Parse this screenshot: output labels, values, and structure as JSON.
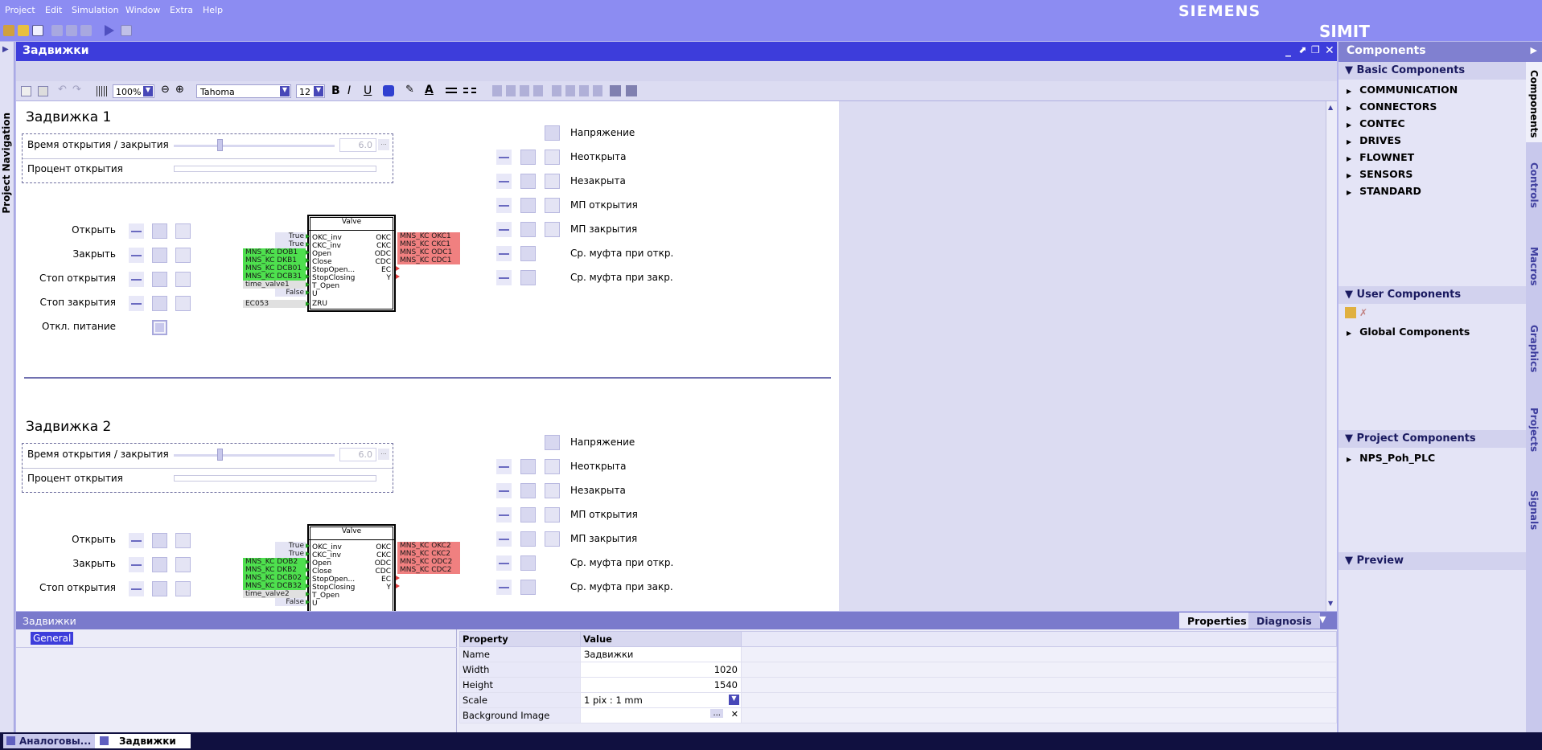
{
  "menu": [
    "Project",
    "Edit",
    "Simulation",
    "Window",
    "Extra",
    "Help"
  ],
  "brand": "SIEMENS",
  "product": "SIMIT",
  "left_tab": "Project Navigation",
  "editor": {
    "title": "Задвижки",
    "zoom": "100%",
    "font": "Tahoma",
    "font_size": "12",
    "bold": "B",
    "italic": "I",
    "underline": "U"
  },
  "blocks": [
    {
      "title": "Задвижка 1",
      "time_label": "Время открытия / закрытия",
      "time_value": "6.0",
      "percent_label": "Процент открытия",
      "slider_fraction": 0.27,
      "buttons": [
        "Открыть",
        "Закрыть",
        "Стоп открытия",
        "Стоп закрытия",
        "Откл. питание"
      ],
      "status": [
        "Напряжение",
        "Неоткрыта",
        "Незакрыта",
        "МП открытия",
        "МП закрытия",
        "Ср. муфта при откр.",
        "Ср. муфта при закр."
      ],
      "valve": {
        "name": "Valve",
        "inputs": [
          "OKC_inv",
          "CKC_inv",
          "Open",
          "Close",
          "StopOpen...",
          "StopClosing",
          "T_Open",
          "U",
          "ZRU"
        ],
        "outputs": [
          "OKC",
          "CKC",
          "ODC",
          "CDC",
          "EC",
          "Y"
        ],
        "in_tags": [
          "True",
          "True",
          "MNS_KC DOB1",
          "MNS_KC DKB1",
          "MNS_KC DCB01",
          "MNS_KC DCB31",
          "time_valve1",
          "False",
          "EC053"
        ],
        "out_tags": [
          "MNS_KC OKC1",
          "MNS_KC CKC1",
          "MNS_KC ODC1",
          "MNS_KC CDC1"
        ]
      }
    },
    {
      "title": "Задвижка 2",
      "time_label": "Время открытия / закрытия",
      "time_value": "6.0",
      "percent_label": "Процент открытия",
      "slider_fraction": 0.27,
      "buttons": [
        "Открыть",
        "Закрыть",
        "Стоп открытия"
      ],
      "status": [
        "Напряжение",
        "Неоткрыта",
        "Незакрыта",
        "МП открытия",
        "МП закрытия",
        "Ср. муфта при откр.",
        "Ср. муфта при закр."
      ],
      "valve": {
        "name": "Valve",
        "inputs": [
          "OKC_inv",
          "CKC_inv",
          "Open",
          "Close",
          "StopOpen...",
          "StopClosing",
          "T_Open",
          "U"
        ],
        "outputs": [
          "OKC",
          "CKC",
          "ODC",
          "CDC",
          "EC",
          "Y"
        ],
        "in_tags": [
          "True",
          "True",
          "MNS_KC DOB2",
          "MNS_KC DKB2",
          "MNS_KC DCB02",
          "MNS_KC DCB32",
          "time_valve2",
          "False"
        ],
        "out_tags": [
          "MNS_KC OKC2",
          "MNS_KC CKC2",
          "MNS_KC ODC2",
          "MNS_KC CDC2"
        ]
      }
    }
  ],
  "components_panel": {
    "title": "Components",
    "basic": "Basic Components",
    "basic_items": [
      "COMMUNICATION",
      "CONNECTORS",
      "CONTEC",
      "DRIVES",
      "FLOWNET",
      "SENSORS",
      "STANDARD"
    ],
    "user": "User Components",
    "user_items": [
      "Global Components"
    ],
    "project": "Project Components",
    "project_items": [
      "NPS_Poh_PLC"
    ],
    "preview": "Preview"
  },
  "side_tabs": [
    "Components",
    "Controls",
    "Macros",
    "Graphics",
    "Projects",
    "Signals"
  ],
  "properties": {
    "title": "Задвижки",
    "tabs": [
      "Properties",
      "Diagnosis"
    ],
    "category": "General",
    "header": [
      "Property",
      "Value"
    ],
    "rows": [
      {
        "name": "Name",
        "value": "Задвижки"
      },
      {
        "name": "Width",
        "value": "1020"
      },
      {
        "name": "Height",
        "value": "1540"
      },
      {
        "name": "Scale",
        "value": "1 pix : 1 mm"
      },
      {
        "name": "Background Image",
        "value": ""
      }
    ]
  },
  "taskbar": [
    "Аналоговы...",
    "Задвижки"
  ]
}
